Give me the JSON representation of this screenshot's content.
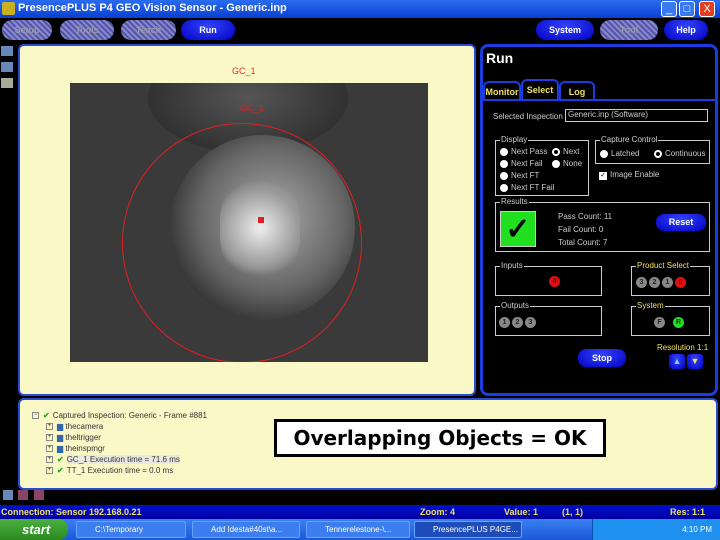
{
  "window": {
    "title": "PresencePLUS  P4 GEO Vision Sensor - Generic.inp",
    "min": "_",
    "max": "□",
    "close": "X"
  },
  "toolbar": {
    "setup": "Setup",
    "tools": "Tools",
    "teach": "Teach",
    "run": "Run",
    "system": "System",
    "tool": "Tool",
    "help": "Help"
  },
  "image": {
    "tool_label_top": "GC_1",
    "tool_label_red": "GC_1"
  },
  "run": {
    "title": "Run",
    "tabs": [
      "Monitor",
      "Select",
      "Log"
    ],
    "selected_inspection_label": "Selected Inspection",
    "selected_inspection_value": "Generic.inp (Software)",
    "display": {
      "label": "Display",
      "options": [
        "Next Pass",
        "Next Fail",
        "Next FT",
        "Next FT Fail",
        "Next",
        "None"
      ],
      "selected": "Next"
    },
    "capture": {
      "label": "Capture Control",
      "options": [
        "Latched",
        "Continuous"
      ],
      "selected": "Continuous",
      "image_enable_label": "Image Enable",
      "image_enable": true
    },
    "results": {
      "label": "Results",
      "pass_label": "Pass Count:",
      "pass": "11",
      "fail_label": "Fail Count:",
      "fail": "0",
      "total_label": "Total Count:",
      "total": "7",
      "reset": "Reset"
    },
    "inputs": {
      "label": "Inputs",
      "items": [
        "4"
      ]
    },
    "product_select": {
      "label": "Product Select",
      "items": [
        "3",
        "2",
        "1",
        "0"
      ]
    },
    "outputs": {
      "label": "Outputs",
      "items": [
        "1",
        "2",
        "3"
      ]
    },
    "system": {
      "label": "System",
      "items": [
        "F",
        "R"
      ]
    },
    "resolution": "Resolution 1:1",
    "stop": "Stop",
    "up": "▲",
    "down": "▼"
  },
  "tree": {
    "root": "Captured Inspection: Generic - Frame #881",
    "items": [
      "thecamera",
      "theltrigger",
      "theinspmgr",
      "GC_1 Execution time = 71.6 ms",
      "TT_1 Execution time = 0.0 ms"
    ]
  },
  "overlay": "Overlapping Objects = OK",
  "status": {
    "connection": "Connection: Sensor 192.168.0.21",
    "zoom": "Zoom: 4",
    "value": "Value: 1",
    "coords": "(1, 1)",
    "res": "Res: 1:1"
  },
  "taskbar": {
    "start": "start",
    "tasks": [
      "C:\\Temporary",
      "Add Idesta#40st\\a...",
      "Tennerelestone-\\...",
      "PresencePLUS P4GE..."
    ],
    "clock": "4:10 PM"
  },
  "colors": {
    "accent": "#1a3ce0",
    "pass_green": "#20e020",
    "fail_red": "#e01010"
  }
}
